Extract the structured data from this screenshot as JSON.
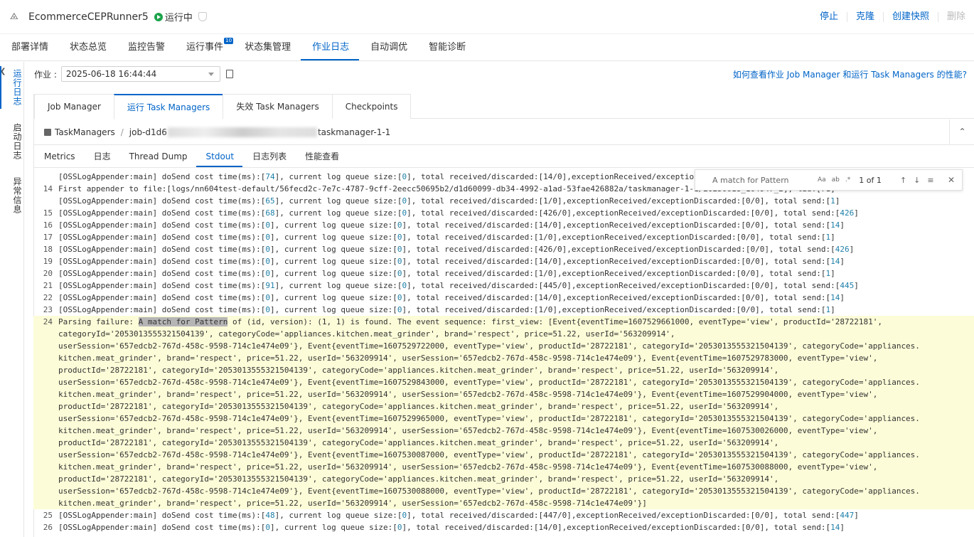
{
  "header": {
    "app_icon": "cluster-icon",
    "job_name": "EcommerceCEPRunner5",
    "status": "运行中",
    "actions": [
      "停止",
      "克隆",
      "创建快照",
      "删除"
    ]
  },
  "main_tabs": [
    {
      "label": "部署详情"
    },
    {
      "label": "状态总览"
    },
    {
      "label": "监控告警"
    },
    {
      "label": "运行事件",
      "badge": "10"
    },
    {
      "label": "状态集管理"
    },
    {
      "label": "作业日志",
      "active": true
    },
    {
      "label": "自动调优"
    },
    {
      "label": "智能诊断"
    }
  ],
  "left_nav": {
    "items": [
      "运行日志",
      "启动日志",
      "异常信息"
    ]
  },
  "selector": {
    "label": "作业 :",
    "value": "2025-06-18 16:44:44",
    "help_link": "如何查看作业 Job Manager 和运行 Task Managers 的性能?"
  },
  "sub_tabs": [
    "Job Manager",
    "运行 Task Managers",
    "失效 Task Managers",
    "Checkpoints"
  ],
  "breadcrumb": {
    "root": "TaskManagers",
    "separator": "/",
    "job_prefix": "job-d1d6",
    "job_suffix": "taskmanager-1-1"
  },
  "inner_tabs": [
    "Metrics",
    "日志",
    "Thread Dump",
    "Stdout",
    "日志列表",
    "性能查看"
  ],
  "find": {
    "query": "A match for Pattern",
    "opt_case": "Aa",
    "opt_word": "ab",
    "opt_regex": ".*",
    "count": "1 of 1"
  },
  "log": {
    "lines": [
      {
        "n": "",
        "pre": "[OSSLogAppender:main] doSend cost time(ms):[",
        "a": "74",
        "b": "], current log queue size:[",
        "c": "0",
        "d": "], total received/discarded:[14/0],exceptionReceived/exceptionDiscarded:[0/0], total send:[",
        "e": "14",
        "f": "]"
      },
      {
        "n": "14",
        "raw": "First appender to file:[logs/nn604test-default/56fecd2c-7e7c-4787-9cff-2eecc50695b2/d1d60099-db34-4992-a1ad-53fae426882a/taskmanager-1-1/20250618_164947_2], tid:[71]"
      },
      {
        "n": "",
        "pre": "[OSSLogAppender:main] doSend cost time(ms):[",
        "a": "65",
        "b": "], current log queue size:[",
        "c": "0",
        "d": "], total received/discarded:[1/0],exceptionReceived/exceptionDiscarded:[0/0], total send:[",
        "e": "1",
        "f": "]"
      },
      {
        "n": "15",
        "pre": "[OSSLogAppender:main] doSend cost time(ms):[",
        "a": "68",
        "b": "], current log queue size:[",
        "c": "0",
        "d": "], total received/discarded:[426/0],exceptionReceived/exceptionDiscarded:[0/0], total send:[",
        "e": "426",
        "f": "]"
      },
      {
        "n": "16",
        "pre": "[OSSLogAppender:main] doSend cost time(ms):[",
        "a": "0",
        "b": "], current log queue size:[",
        "c": "0",
        "d": "], total received/discarded:[14/0],exceptionReceived/exceptionDiscarded:[0/0], total send:[",
        "e": "14",
        "f": "]"
      },
      {
        "n": "17",
        "pre": "[OSSLogAppender:main] doSend cost time(ms):[",
        "a": "0",
        "b": "], current log queue size:[",
        "c": "0",
        "d": "], total received/discarded:[1/0],exceptionReceived/exceptionDiscarded:[0/0], total send:[",
        "e": "1",
        "f": "]"
      },
      {
        "n": "18",
        "pre": "[OSSLogAppender:main] doSend cost time(ms):[",
        "a": "0",
        "b": "], current log queue size:[",
        "c": "0",
        "d": "], total received/discarded:[426/0],exceptionReceived/exceptionDiscarded:[0/0], total send:[",
        "e": "426",
        "f": "]"
      },
      {
        "n": "19",
        "pre": "[OSSLogAppender:main] doSend cost time(ms):[",
        "a": "0",
        "b": "], current log queue size:[",
        "c": "0",
        "d": "], total received/discarded:[14/0],exceptionReceived/exceptionDiscarded:[0/0], total send:[",
        "e": "14",
        "f": "]"
      },
      {
        "n": "20",
        "pre": "[OSSLogAppender:main] doSend cost time(ms):[",
        "a": "0",
        "b": "], current log queue size:[",
        "c": "0",
        "d": "], total received/discarded:[1/0],exceptionReceived/exceptionDiscarded:[0/0], total send:[",
        "e": "1",
        "f": "]"
      },
      {
        "n": "21",
        "pre": "[OSSLogAppender:main] doSend cost time(ms):[",
        "a": "91",
        "b": "], current log queue size:[",
        "c": "0",
        "d": "], total received/discarded:[445/0],exceptionReceived/exceptionDiscarded:[0/0], total send:[",
        "e": "445",
        "f": "]"
      },
      {
        "n": "22",
        "pre": "[OSSLogAppender:main] doSend cost time(ms):[",
        "a": "0",
        "b": "], current log queue size:[",
        "c": "0",
        "d": "], total received/discarded:[14/0],exceptionReceived/exceptionDiscarded:[0/0], total send:[",
        "e": "14",
        "f": "]"
      },
      {
        "n": "23",
        "pre": "[OSSLogAppender:main] doSend cost time(ms):[",
        "a": "0",
        "b": "], current log queue size:[",
        "c": "0",
        "d": "], total received/discarded:[1/0],exceptionReceived/exceptionDiscarded:[0/0], total send:[",
        "e": "1",
        "f": "]"
      }
    ],
    "highlight": {
      "n": "24",
      "before": "Parsing failure: ",
      "match": "A match for Pattern",
      "wrapped": [
        " of (id, version): (1, 1) is found. The event sequence: first_view: [Event{eventTime=1607529661000, eventType='view', productId='28722181',",
        "categoryId='2053013555321504139', categoryCode='appliances.kitchen.meat_grinder', brand='respect', price=51.22, userId='563209914',",
        "userSession='657edcb2-767d-458c-9598-714c1e474e09'}, Event{eventTime=1607529722000, eventType='view', productId='28722181', categoryId='2053013555321504139', categoryCode='appliances.",
        "kitchen.meat_grinder', brand='respect', price=51.22, userId='563209914', userSession='657edcb2-767d-458c-9598-714c1e474e09'}, Event{eventTime=1607529783000, eventType='view',",
        "productId='28722181', categoryId='2053013555321504139', categoryCode='appliances.kitchen.meat_grinder', brand='respect', price=51.22, userId='563209914',",
        "userSession='657edcb2-767d-458c-9598-714c1e474e09'}, Event{eventTime=1607529843000, eventType='view', productId='28722181', categoryId='2053013555321504139', categoryCode='appliances.",
        "kitchen.meat_grinder', brand='respect', price=51.22, userId='563209914', userSession='657edcb2-767d-458c-9598-714c1e474e09'}, Event{eventTime=1607529904000, eventType='view',",
        "productId='28722181', categoryId='2053013555321504139', categoryCode='appliances.kitchen.meat_grinder', brand='respect', price=51.22, userId='563209914',",
        "userSession='657edcb2-767d-458c-9598-714c1e474e09'}, Event{eventTime=1607529965000, eventType='view', productId='28722181', categoryId='2053013555321504139', categoryCode='appliances.",
        "kitchen.meat_grinder', brand='respect', price=51.22, userId='563209914', userSession='657edcb2-767d-458c-9598-714c1e474e09'}, Event{eventTime=1607530026000, eventType='view',",
        "productId='28722181', categoryId='2053013555321504139', categoryCode='appliances.kitchen.meat_grinder', brand='respect', price=51.22, userId='563209914',",
        "userSession='657edcb2-767d-458c-9598-714c1e474e09'}, Event{eventTime=1607530087000, eventType='view', productId='28722181', categoryId='2053013555321504139', categoryCode='appliances.",
        "kitchen.meat_grinder', brand='respect', price=51.22, userId='563209914', userSession='657edcb2-767d-458c-9598-714c1e474e09'}, Event{eventTime=1607530088000, eventType='view',",
        "productId='28722181', categoryId='2053013555321504139', categoryCode='appliances.kitchen.meat_grinder', brand='respect', price=51.22, userId='563209914',",
        "userSession='657edcb2-767d-458c-9598-714c1e474e09'}, Event{eventTime=1607530088000, eventType='view', productId='28722181', categoryId='2053013555321504139', categoryCode='appliances.",
        "kitchen.meat_grinder', brand='respect', price=51.22, userId='563209914', userSession='657edcb2-767d-458c-9598-714c1e474e09'}]"
      ]
    },
    "after": [
      {
        "n": "25",
        "pre": "[OSSLogAppender:main] doSend cost time(ms):[",
        "a": "48",
        "b": "], current log queue size:[",
        "c": "0",
        "d": "], total received/discarded:[447/0],exceptionReceived/exceptionDiscarded:[0/0], total send:[",
        "e": "447",
        "f": "]"
      },
      {
        "n": "26",
        "pre": "[OSSLogAppender:main] doSend cost time(ms):[",
        "a": "0",
        "b": "], current log queue size:[",
        "c": "0",
        "d": "], total received/discarded:[14/0],exceptionReceived/exceptionDiscarded:[0/0], total send:[",
        "e": "14",
        "f": "]"
      }
    ]
  }
}
